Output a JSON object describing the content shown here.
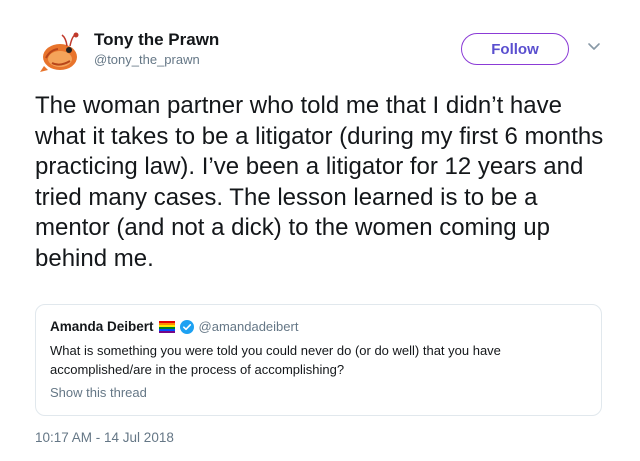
{
  "author": {
    "name": "Tony the Prawn",
    "handle": "@tony_the_prawn",
    "avatar_icon": "prawn-avatar-icon"
  },
  "follow_label": "Follow",
  "menu_icon": "chevron-down-icon",
  "tweet_text": "The woman partner who told me that I didn’t have what it takes to be a litigator (during my first 6 months practicing law). I’ve been a litigator for 12 years and tried many cases. The lesson learned is to be a mentor (and not a dick) to the women coming up behind me.",
  "quoted": {
    "name": "Amanda Deibert",
    "handle": "@amandadeibert",
    "flag_icon": "rainbow-flag-icon",
    "verified_icon": "verified-badge-icon",
    "text": "What is something you were told you could never do (or do well) that you have accomplished/are in the process of accomplishing?",
    "show_thread": "Show this thread"
  },
  "timestamp": "10:17 AM - 14 Jul 2018",
  "colors": {
    "follow_border": "#8b3bd6",
    "follow_text": "#5a4fcf",
    "secondary_text": "#657786",
    "verified": "#1da1f2"
  }
}
